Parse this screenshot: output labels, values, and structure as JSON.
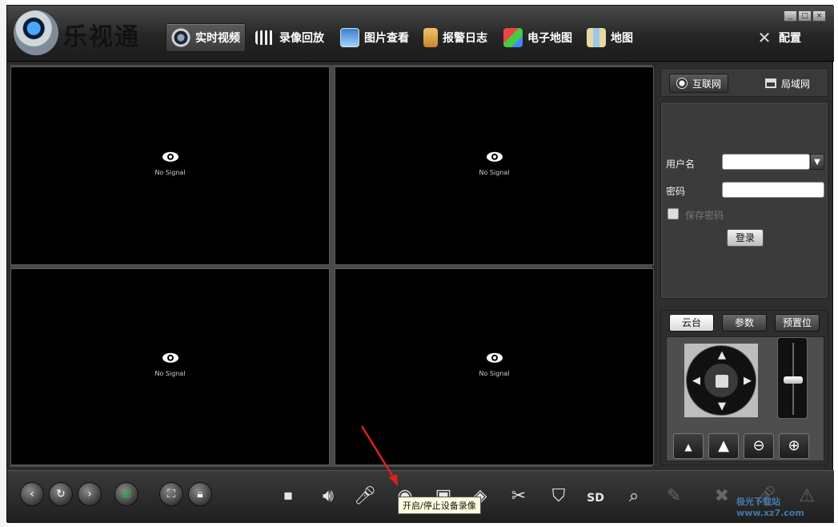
{
  "app": {
    "title": "乐视通",
    "window_controls": [
      "_",
      "□",
      "×"
    ]
  },
  "nav": {
    "tabs": [
      {
        "label": "实时视频",
        "icon": "camera-icon",
        "active": true
      },
      {
        "label": "录像回放",
        "icon": "clapperboard-icon",
        "active": false
      },
      {
        "label": "图片查看",
        "icon": "picture-icon",
        "active": false
      },
      {
        "label": "报警日志",
        "icon": "clipboard-icon",
        "active": false
      },
      {
        "label": "电子地图",
        "icon": "map-pin-icon",
        "active": false
      },
      {
        "label": "地图",
        "icon": "folded-map-icon",
        "active": false
      }
    ],
    "config_label": "配置"
  },
  "video": {
    "cells": [
      {
        "status": "No Signal"
      },
      {
        "status": "No Signal"
      },
      {
        "status": "No Signal"
      },
      {
        "status": "No Signal"
      }
    ]
  },
  "network": {
    "tabs": [
      {
        "label": "互联网",
        "icon": "globe-icon",
        "active": true
      },
      {
        "label": "局域网",
        "icon": "lan-icon",
        "active": false
      }
    ]
  },
  "login": {
    "username_label": "用户名",
    "username_value": "",
    "password_label": "密码",
    "password_value": "",
    "save_password_label": "保存密码",
    "login_button": "登录"
  },
  "ptz": {
    "tabs": [
      {
        "label": "云台",
        "active": true
      },
      {
        "label": "参数",
        "active": false
      },
      {
        "label": "预置位",
        "active": false
      }
    ],
    "zoom_level": 0.5
  },
  "toolbar": {
    "tooltip": "开启/停止设备录像",
    "watermark": "极光下载站 www.xz7.com"
  },
  "colors": {
    "accent_green": "#19c33a",
    "arrow_red": "#e02020"
  }
}
